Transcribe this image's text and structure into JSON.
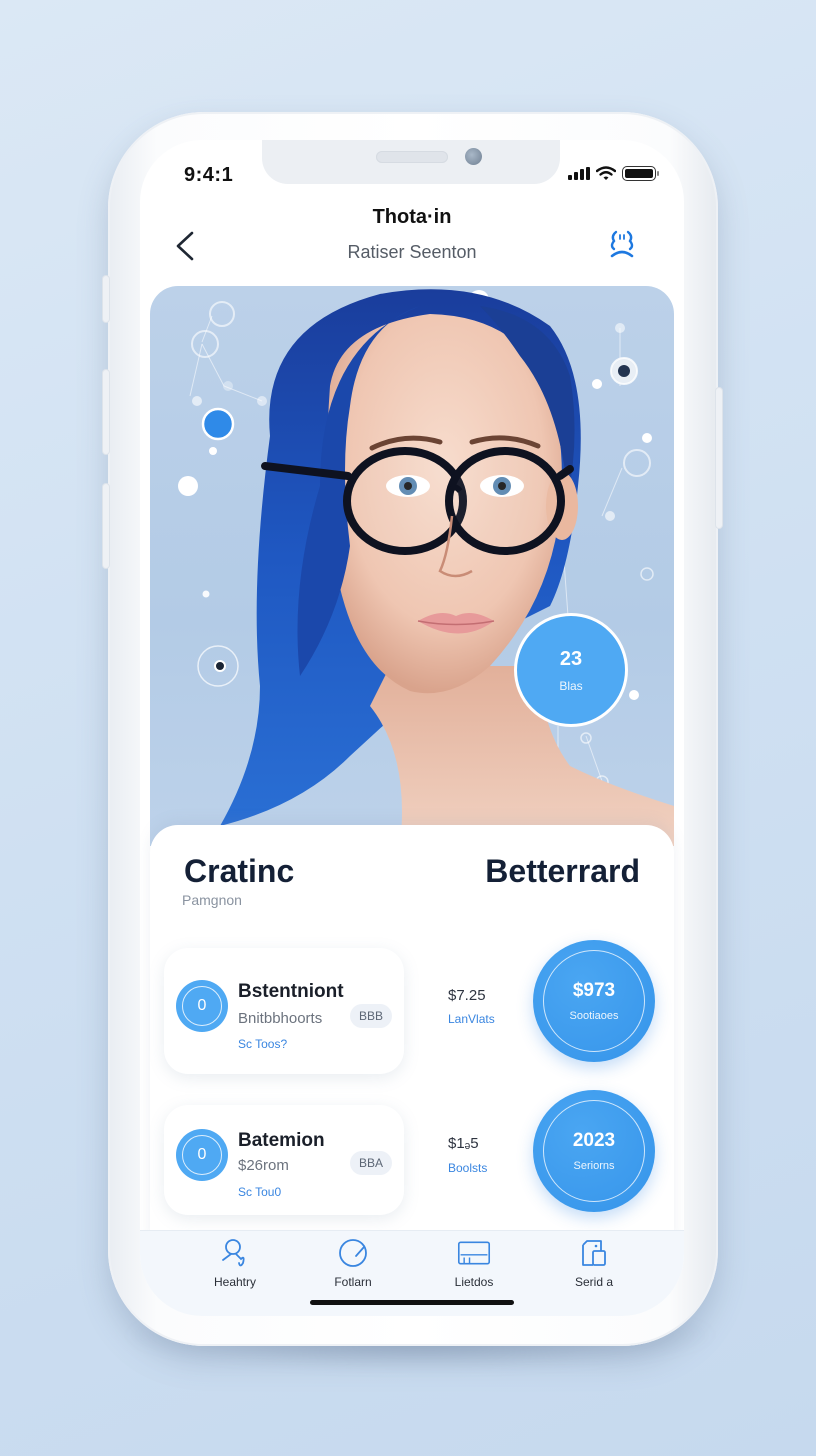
{
  "status_bar": {
    "time": "9:4:1",
    "icons": [
      "signal-icon",
      "wifi-icon",
      "battery-icon"
    ]
  },
  "nav": {
    "title": "Thota·in",
    "subtitle": "Ratiser Seenton",
    "back_icon": "chevron-left-icon",
    "action_icon": "profile-face-icon"
  },
  "hero": {
    "image_description": "Portrait of a woman with blue hair wearing black round glasses",
    "stat_bubble": {
      "value": "23",
      "label": "Blas"
    }
  },
  "panel": {
    "title_left": "Cratinc",
    "title_right": "Betterrard",
    "subtitle": "Pamgnon",
    "items": [
      {
        "avatar_text": "0",
        "name": "Bstentniont",
        "meta": "Bnitbbhoorts",
        "link": "Sc Toos?",
        "chip": "BBB",
        "price": "$7.25",
        "price_label": "LanVlats",
        "circle_value": "$973",
        "circle_label": "Sootiaoes"
      },
      {
        "avatar_text": "0",
        "name": "Batemion",
        "meta": "$26rom",
        "link": "Sc Tou0",
        "chip": "BBA",
        "price": "$1ₔ5",
        "price_label": "Boolsts",
        "circle_value": "2023",
        "circle_label": "Seriorns"
      }
    ]
  },
  "tabbar": {
    "tabs": [
      {
        "label": "Heahtry",
        "icon": "person-icon"
      },
      {
        "label": "Fotlarn",
        "icon": "gauge-icon"
      },
      {
        "label": "Lietdos",
        "icon": "card-icon"
      },
      {
        "label": "Serid a",
        "icon": "building-icon"
      }
    ]
  },
  "colors": {
    "accent": "#4fa9f3",
    "accent_dark": "#3594ea",
    "title_text": "#142036",
    "background": "#d3e3f3"
  }
}
